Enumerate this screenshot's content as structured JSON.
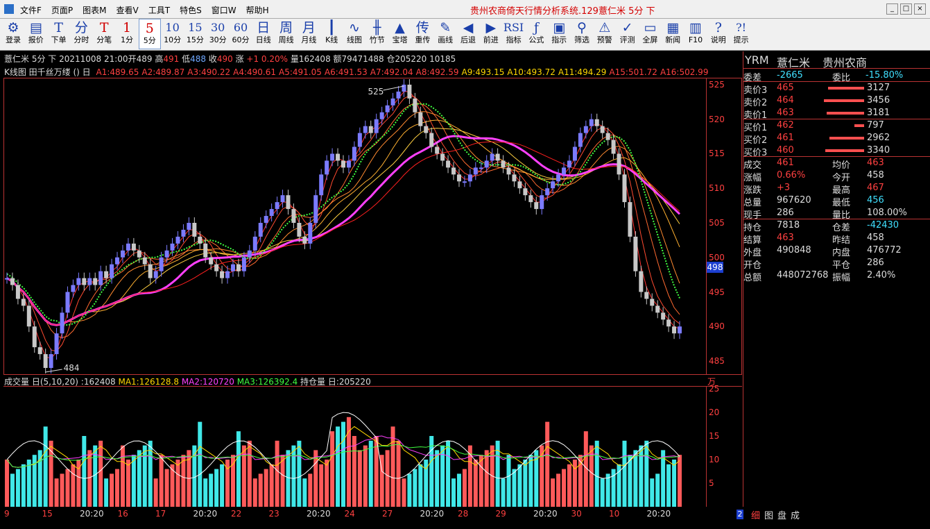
{
  "window": {
    "title": "贵州农商倚天行情分析系统.129薏仁米 5分 下",
    "buttons": [
      "_",
      "□",
      "×"
    ]
  },
  "menu": [
    "文件F",
    "页面P",
    "图表M",
    "查看V",
    "工具T",
    "特色S",
    "窗口W",
    "帮助H"
  ],
  "toolbar": [
    {
      "icon": "login-icon",
      "glyph": "⚙",
      "label": "登录"
    },
    {
      "icon": "quote-icon",
      "glyph": "▤",
      "label": "报价"
    },
    {
      "icon": "order-icon",
      "glyph": "T",
      "label": "下单"
    },
    {
      "icon": "minute-icon",
      "glyph": "分",
      "label": "分时"
    },
    {
      "icon": "tick-icon",
      "glyph": "T",
      "label": "分笔"
    },
    {
      "icon": "1min-icon",
      "glyph": "1",
      "label": "1分"
    },
    {
      "icon": "5min-icon",
      "glyph": "5",
      "label": "5分"
    },
    {
      "icon": "10min-icon",
      "glyph": "10",
      "label": "10分"
    },
    {
      "icon": "15min-icon",
      "glyph": "15",
      "label": "15分"
    },
    {
      "icon": "30min-icon",
      "glyph": "30",
      "label": "30分"
    },
    {
      "icon": "60min-icon",
      "glyph": "60",
      "label": "60分"
    },
    {
      "icon": "day-icon",
      "glyph": "日",
      "label": "日线"
    },
    {
      "icon": "week-icon",
      "glyph": "周",
      "label": "周线"
    },
    {
      "icon": "month-icon",
      "glyph": "月",
      "label": "月线"
    },
    {
      "icon": "kline-icon",
      "glyph": "┃",
      "label": "K线"
    },
    {
      "icon": "linechart-icon",
      "glyph": "∿",
      "label": "线图"
    },
    {
      "icon": "bamboo-icon",
      "glyph": "╫",
      "label": "竹节"
    },
    {
      "icon": "tower-icon",
      "glyph": "▲",
      "label": "宝塔"
    },
    {
      "icon": "replay-icon",
      "glyph": "传",
      "label": "重传"
    },
    {
      "icon": "draw-icon",
      "glyph": "✎",
      "label": "画线"
    },
    {
      "icon": "back-icon",
      "glyph": "◀",
      "label": "后退"
    },
    {
      "icon": "forward-icon",
      "glyph": "▶",
      "label": "前进"
    },
    {
      "icon": "indicator-icon",
      "glyph": "RSI",
      "label": "指标"
    },
    {
      "icon": "formula-icon",
      "glyph": "ƒ",
      "label": "公式"
    },
    {
      "icon": "instruction-icon",
      "glyph": "▣",
      "label": "指示"
    },
    {
      "icon": "filter-icon",
      "glyph": "⚲",
      "label": "筛选"
    },
    {
      "icon": "alert-icon",
      "glyph": "⚠",
      "label": "预警"
    },
    {
      "icon": "review-icon",
      "glyph": "✓",
      "label": "评测"
    },
    {
      "icon": "fullscreen-icon",
      "glyph": "▭",
      "label": "全屏"
    },
    {
      "icon": "news-icon",
      "glyph": "▦",
      "label": "新闻"
    },
    {
      "icon": "f10-icon",
      "glyph": "▥",
      "label": "F10"
    },
    {
      "icon": "explain-icon",
      "glyph": "?",
      "label": "说明"
    },
    {
      "icon": "tips-icon",
      "glyph": "?!",
      "label": "提示"
    }
  ],
  "info": {
    "name": "薏仁米 5分 下",
    "datetime": "20211008 21:00",
    "open_label": "开",
    "open": "489",
    "high_label": "高",
    "high": "491",
    "low_label": "低",
    "low": "488",
    "close_label": "收",
    "close": "490",
    "change_label": "涨",
    "change": "+1 0.20%",
    "volume_label": "量",
    "volume": "162408",
    "amount_label": "额",
    "amount": "79471488",
    "oi_label": "仓",
    "oi": "205220 10185"
  },
  "ma_line": {
    "prefix": "K线图 田千丝万缕 () 日",
    "items": [
      {
        "t": "A1:489.65",
        "c": "#ff4040"
      },
      {
        "t": "A2:489.87",
        "c": "#ff4040"
      },
      {
        "t": "A3:490.22",
        "c": "#ff4040"
      },
      {
        "t": "A4:490.61",
        "c": "#ff4040"
      },
      {
        "t": "A5:491.05",
        "c": "#ff4040"
      },
      {
        "t": "A6:491.53",
        "c": "#ff4040"
      },
      {
        "t": "A7:492.04",
        "c": "#ff4040"
      },
      {
        "t": "A8:492.59",
        "c": "#ff4040"
      },
      {
        "t": "A9:493.15",
        "c": "#ffd700"
      },
      {
        "t": "A10:493.72",
        "c": "#ffd700"
      },
      {
        "t": "A11:494.29",
        "c": "#ffd700"
      },
      {
        "t": "A15:501.72",
        "c": "#ff4040"
      },
      {
        "t": "A16:502.99",
        "c": "#ff4040"
      }
    ]
  },
  "price_axis": {
    "labels": [
      "525",
      "520",
      "515",
      "510",
      "505",
      "500",
      "495",
      "490",
      "485"
    ],
    "current": "498"
  },
  "annotations": {
    "high": "525",
    "low": "484"
  },
  "volume": {
    "prefix": "成交量 日(5,10,20) :162408",
    "ma1": "MA1:126128.8",
    "ma2": "MA2:120720",
    "ma3": "MA3:126392.4",
    "oi": "持仓量 日:205220",
    "unit": "万",
    "axis": [
      "25",
      "20",
      "15",
      "10",
      "5"
    ]
  },
  "time_axis": [
    "9",
    "15",
    "20:20",
    "16",
    "17",
    "20:20",
    "22",
    "23",
    "20:20",
    "24",
    "27",
    "20:20",
    "28",
    "29",
    "20:20",
    "30",
    "10",
    "20:20"
  ],
  "scroll_num": "2",
  "right_panel": {
    "head": [
      "YRM",
      "薏仁米",
      "贵州农商"
    ],
    "wei": [
      {
        "l": "委差",
        "v": "-2665",
        "c": "#40e0ff"
      },
      {
        "l": "委比",
        "v": "-15.80%",
        "c": "#40e0ff"
      }
    ],
    "asks": [
      {
        "l": "卖价3",
        "p": "465",
        "q": "3127",
        "w": 52
      },
      {
        "l": "卖价2",
        "p": "464",
        "q": "3456",
        "w": 58
      },
      {
        "l": "卖价1",
        "p": "463",
        "q": "3181",
        "w": 54
      }
    ],
    "bids": [
      {
        "l": "买价1",
        "p": "462",
        "q": "797",
        "w": 14
      },
      {
        "l": "买价2",
        "p": "461",
        "q": "2962",
        "w": 50
      },
      {
        "l": "买价3",
        "p": "460",
        "q": "3340",
        "w": 56
      }
    ],
    "stats": [
      [
        {
          "l": "成交",
          "v": "461",
          "c": "#ff4040"
        },
        {
          "l": "均价",
          "v": "463",
          "c": "#ff4040"
        }
      ],
      [
        {
          "l": "涨幅",
          "v": "0.66%",
          "c": "#ff4040"
        },
        {
          "l": "今开",
          "v": "458",
          "c": "#ddd"
        }
      ],
      [
        {
          "l": "涨跌",
          "v": "+3",
          "c": "#ff4040"
        },
        {
          "l": "最高",
          "v": "467",
          "c": "#ff4040"
        }
      ],
      [
        {
          "l": "总量",
          "v": "967620",
          "c": "#ddd"
        },
        {
          "l": "最低",
          "v": "456",
          "c": "#40e0ff"
        }
      ],
      [
        {
          "l": "现手",
          "v": "286",
          "c": "#ddd"
        },
        {
          "l": "量比",
          "v": "108.00%",
          "c": "#ddd"
        }
      ],
      [
        {
          "l": "持仓",
          "v": "7818",
          "c": "#ddd"
        },
        {
          "l": "仓差",
          "v": "-42430",
          "c": "#40e0ff"
        }
      ],
      [
        {
          "l": "结算",
          "v": "463",
          "c": "#ff4040"
        },
        {
          "l": "昨结",
          "v": "458",
          "c": "#ddd"
        }
      ],
      [
        {
          "l": "外盘",
          "v": "490848",
          "c": "#ddd"
        },
        {
          "l": "内盘",
          "v": "476772",
          "c": "#ddd"
        }
      ],
      [
        {
          "l": "开仓",
          "v": "",
          "c": "#ddd"
        },
        {
          "l": "平仓",
          "v": "286",
          "c": "#ddd"
        }
      ],
      [
        {
          "l": "总额",
          "v": "448072768",
          "c": "#ddd"
        },
        {
          "l": "振幅",
          "v": "2.40%",
          "c": "#ddd"
        }
      ]
    ],
    "tabs": [
      "细",
      "图",
      "盘",
      "成"
    ]
  },
  "chart_data": {
    "type": "candlestick",
    "y_range": [
      484,
      526
    ],
    "closes": [
      497,
      496,
      494,
      493,
      490,
      487,
      486,
      484,
      486,
      489,
      492,
      495,
      496,
      497,
      496,
      497,
      496,
      498,
      497,
      499,
      500,
      501,
      502,
      501,
      500,
      499,
      497,
      498,
      500,
      501,
      502,
      503,
      504,
      505,
      503,
      502,
      500,
      499,
      498,
      497,
      498,
      499,
      498,
      500,
      501,
      503,
      505,
      506,
      507,
      508,
      509,
      507,
      505,
      503,
      502,
      505,
      509,
      512,
      514,
      515,
      514,
      513,
      514,
      516,
      518,
      519,
      518,
      520,
      521,
      522,
      523,
      524,
      525,
      523,
      521,
      519,
      518,
      516,
      515,
      514,
      513,
      512,
      511,
      511,
      512,
      513,
      513,
      514,
      515,
      514,
      513,
      512,
      511,
      510,
      509,
      508,
      507,
      509,
      510,
      511,
      512,
      513,
      514,
      516,
      518,
      519,
      520,
      519,
      518,
      517,
      515,
      512,
      508,
      503,
      498,
      495,
      494,
      493,
      492,
      491,
      490,
      489,
      490
    ]
  }
}
